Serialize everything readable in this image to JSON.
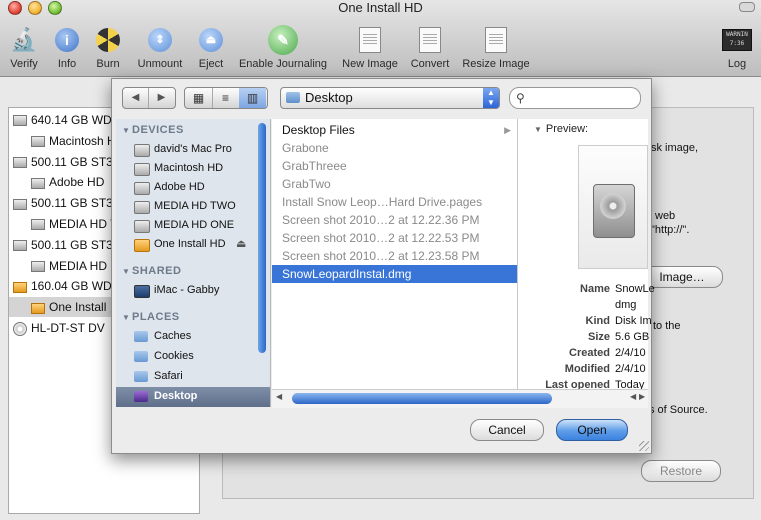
{
  "window": {
    "title": "One Install HD"
  },
  "toolbar": {
    "items": [
      {
        "label": "Verify"
      },
      {
        "label": "Info"
      },
      {
        "label": "Burn"
      },
      {
        "label": "Unmount"
      },
      {
        "label": "Eject"
      },
      {
        "label": "Enable Journaling"
      },
      {
        "label": "New Image"
      },
      {
        "label": "Convert"
      },
      {
        "label": "Resize Image"
      },
      {
        "label": "Log"
      }
    ],
    "log_badge": "WARNIN 7:36"
  },
  "sidebar": {
    "disks": [
      {
        "label": "640.14 GB WD",
        "indent": false
      },
      {
        "label": "Macintosh H",
        "indent": true
      },
      {
        "label": "500.11 GB ST3",
        "indent": false
      },
      {
        "label": "Adobe HD",
        "indent": true
      },
      {
        "label": "500.11 GB ST3",
        "indent": false
      },
      {
        "label": "MEDIA HD T",
        "indent": true
      },
      {
        "label": "500.11 GB ST3",
        "indent": false
      },
      {
        "label": "MEDIA HD O",
        "indent": true
      },
      {
        "label": "160.04 GB WD",
        "indent": false
      },
      {
        "label": "One Install",
        "indent": true
      },
      {
        "label": "HL-DT-ST DV",
        "indent": false
      }
    ]
  },
  "main_fragments": {
    "disk_image": "sk image,",
    "web": "web",
    "http": "\"http://\".",
    "to_the": "to the",
    "of_source": "s of Source.",
    "image_button": "Image…",
    "restore_button": "Restore"
  },
  "dialog": {
    "location": "Desktop",
    "search_placeholder": "",
    "sections": {
      "devices": {
        "title": "DEVICES",
        "items": [
          "david's Mac Pro",
          "Macintosh HD",
          "Adobe HD",
          "MEDIA HD TWO",
          "MEDIA HD ONE",
          "One Install HD"
        ]
      },
      "shared": {
        "title": "SHARED",
        "items": [
          "iMac - Gabby"
        ]
      },
      "places": {
        "title": "PLACES",
        "items": [
          "Caches",
          "Cookies",
          "Safari",
          "Desktop"
        ]
      }
    },
    "files": [
      {
        "name": "Desktop Files",
        "dim": false,
        "folder": true
      },
      {
        "name": "Grabone",
        "dim": true
      },
      {
        "name": "GrabThreee",
        "dim": true
      },
      {
        "name": "GrabTwo",
        "dim": true
      },
      {
        "name": "Install Snow Leop…Hard Drive.pages",
        "dim": true
      },
      {
        "name": "Screen shot 2010…2 at 12.22.36 PM",
        "dim": true
      },
      {
        "name": "Screen shot 2010…2 at 12.22.53 PM",
        "dim": true
      },
      {
        "name": "Screen shot 2010…2 at 12.23.58 PM",
        "dim": true
      },
      {
        "name": "SnowLeopardInstal.dmg",
        "dim": false,
        "selected": true
      }
    ],
    "preview": {
      "label": "Preview:",
      "meta": [
        {
          "key": "Name",
          "value": "SnowLe"
        },
        {
          "key": "",
          "value": "dmg"
        },
        {
          "key": "Kind",
          "value": "Disk Im"
        },
        {
          "key": "Size",
          "value": "5.6 GB"
        },
        {
          "key": "Created",
          "value": "2/4/10"
        },
        {
          "key": "Modified",
          "value": "2/4/10"
        },
        {
          "key": "Last opened",
          "value": "Today"
        }
      ]
    },
    "cancel_label": "Cancel",
    "open_label": "Open"
  }
}
